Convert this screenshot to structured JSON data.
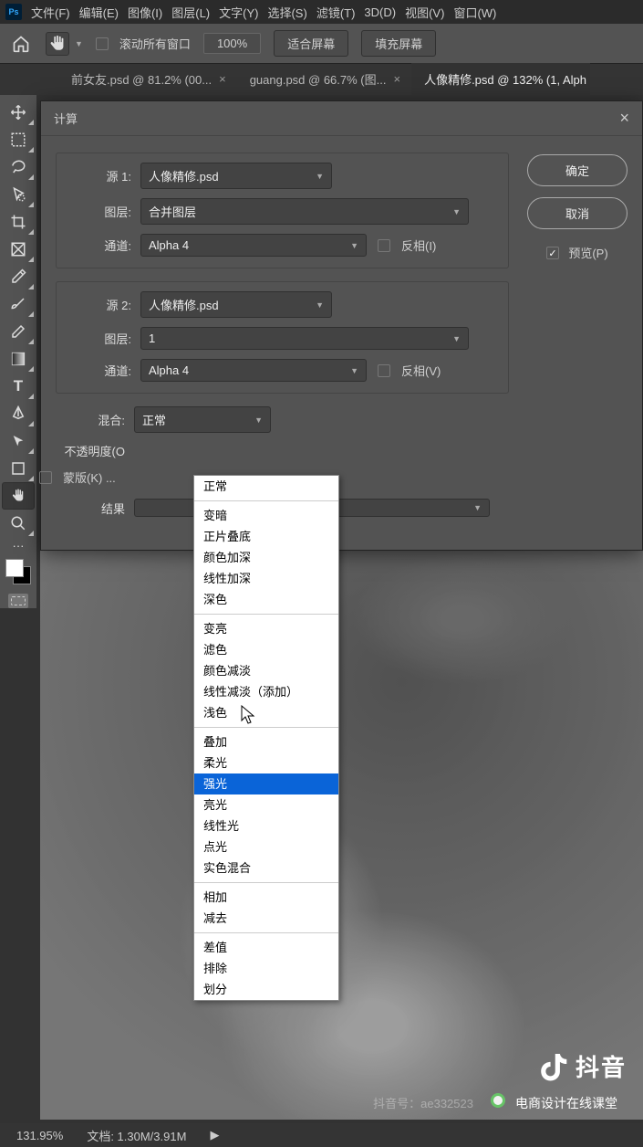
{
  "menu": [
    "文件(F)",
    "编辑(E)",
    "图像(I)",
    "图层(L)",
    "文字(Y)",
    "选择(S)",
    "滤镜(T)",
    "3D(D)",
    "视图(V)",
    "窗口(W)"
  ],
  "opt": {
    "scroll_all": "滚动所有窗口",
    "zoom": "100%",
    "fit": "适合屏幕",
    "fill": "填充屏幕"
  },
  "tabs": [
    "前女友.psd @ 81.2% (00...",
    "guang.psd @ 66.7% (图...",
    "人像精修.psd @ 132% (1, Alph"
  ],
  "dialog": {
    "title": "计算",
    "source1_label": "源 1:",
    "source2_label": "源 2:",
    "layer_label": "图层:",
    "channel_label": "通道:",
    "invert1": "反相(I)",
    "invert2": "反相(V)",
    "blend_label": "混合:",
    "opacity_label": "不透明度(O",
    "mask_label": "蒙版(K) ...",
    "result_label": "结果",
    "ok": "确定",
    "cancel": "取消",
    "preview": "预览(P)",
    "src_file": "人像精修.psd",
    "layer1": "合并图层",
    "layer2": "1",
    "channel": "Alpha 4",
    "blend_value": "正常"
  },
  "blend_modes": {
    "g1": [
      "正常"
    ],
    "g2": [
      "变暗",
      "正片叠底",
      "颜色加深",
      "线性加深",
      "深色"
    ],
    "g3": [
      "变亮",
      "滤色",
      "颜色减淡",
      "线性减淡（添加）",
      "浅色"
    ],
    "g4": [
      "叠加",
      "柔光",
      "强光",
      "亮光",
      "线性光",
      "点光",
      "实色混合"
    ],
    "g5": [
      "相加",
      "减去"
    ],
    "g6": [
      "差值",
      "排除",
      "划分"
    ],
    "highlight": "强光"
  },
  "watermark": {
    "app": "抖音",
    "line2": "抖音号：ae332523",
    "credit": "电商设计在线课堂"
  },
  "status": {
    "zoom": "131.95%",
    "doc": "文档: 1.30M/3.91M"
  }
}
